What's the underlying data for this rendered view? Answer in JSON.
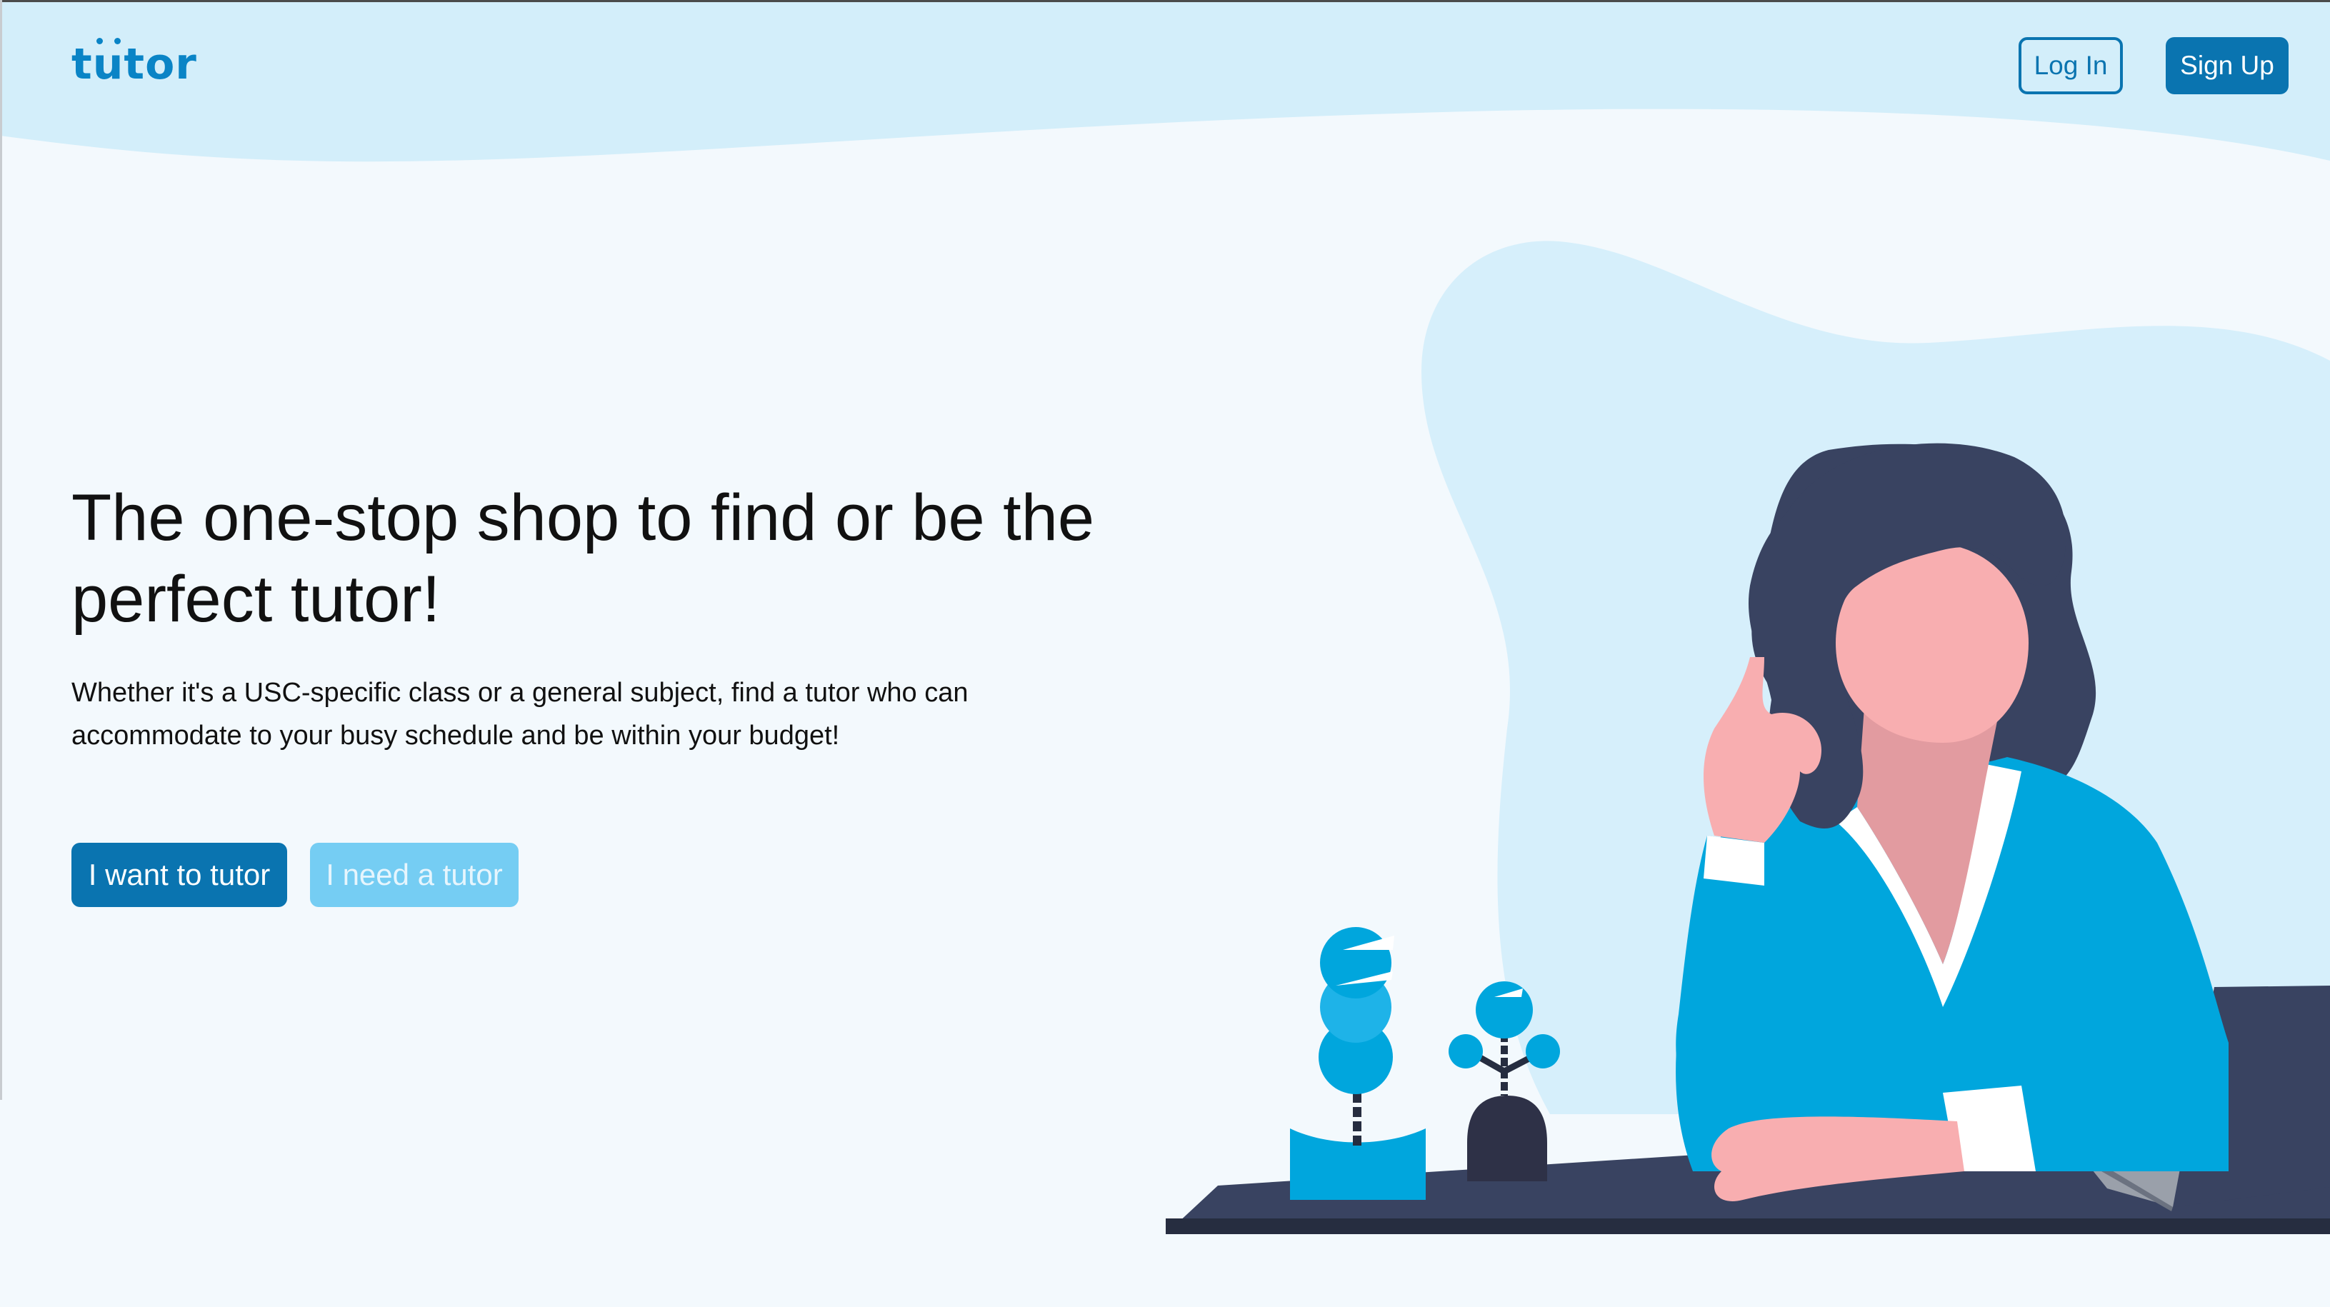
{
  "header": {
    "logo_text_start": "t",
    "logo_text_u": "u",
    "logo_text_end": "tor",
    "login_label": "Log In",
    "signup_label": "Sign Up"
  },
  "hero": {
    "title": "The one-stop shop to find or be the perfect tutor!",
    "subtitle": "Whether it's a USC-specific class or a general subject, find a tutor who can accommodate to your busy schedule and be within your budget!",
    "primary_cta": "I want to tutor",
    "secondary_cta": "I need a tutor"
  },
  "colors": {
    "brand": "#0a74b0",
    "brand_light": "#75cdf3",
    "logo": "#0a84c6",
    "header_bg": "#d3eefa",
    "page_bg": "#f3f9fd",
    "blob": "#d6effb",
    "sweater": "#00a6dd",
    "hair": "#394361",
    "skin": "#f8aeb0",
    "desk": "#394361"
  },
  "icons": {
    "logo": "tutor-logo",
    "illustration": "woman-thinking-at-desk-illustration"
  }
}
